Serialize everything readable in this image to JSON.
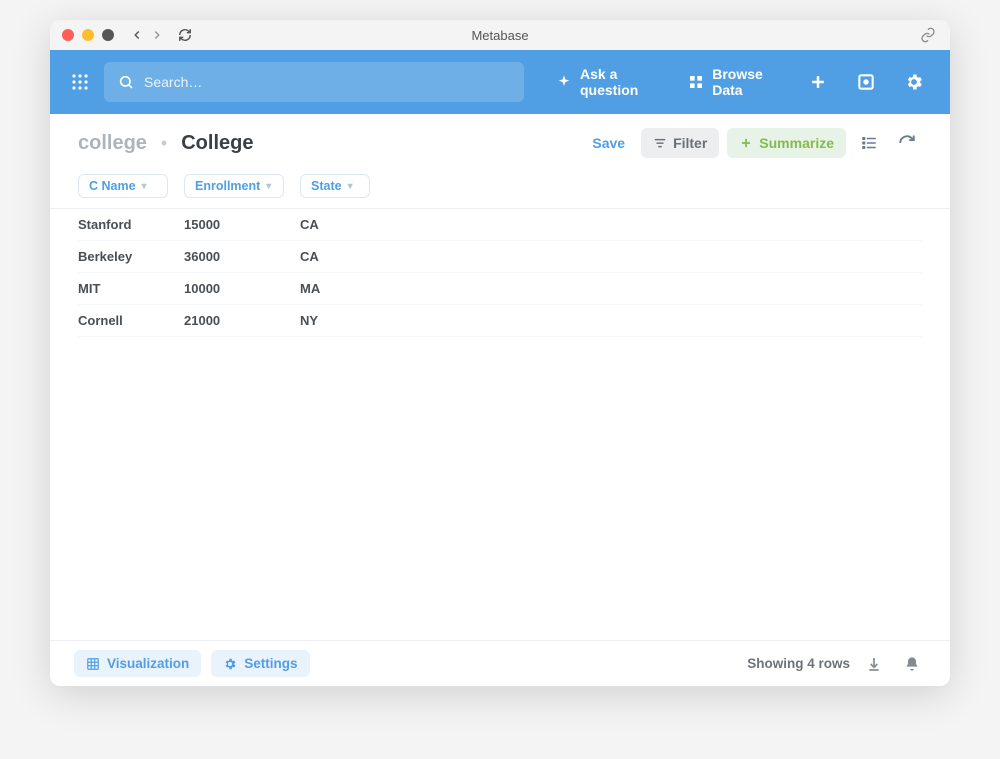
{
  "window": {
    "title": "Metabase"
  },
  "nav": {
    "search_placeholder": "Search…",
    "ask_label": "Ask a question",
    "browse_label": "Browse Data"
  },
  "header": {
    "breadcrumb": "college",
    "title": "College",
    "save_label": "Save",
    "filter_label": "Filter",
    "summarize_label": "Summarize"
  },
  "columns": [
    {
      "label": "C Name"
    },
    {
      "label": "Enrollment"
    },
    {
      "label": "State"
    }
  ],
  "rows": [
    {
      "c_name": "Stanford",
      "enrollment": "15000",
      "state": "CA"
    },
    {
      "c_name": "Berkeley",
      "enrollment": "36000",
      "state": "CA"
    },
    {
      "c_name": "MIT",
      "enrollment": "10000",
      "state": "MA"
    },
    {
      "c_name": "Cornell",
      "enrollment": "21000",
      "state": "NY"
    }
  ],
  "footer": {
    "visualization_label": "Visualization",
    "settings_label": "Settings",
    "row_count_label": "Showing 4 rows"
  }
}
